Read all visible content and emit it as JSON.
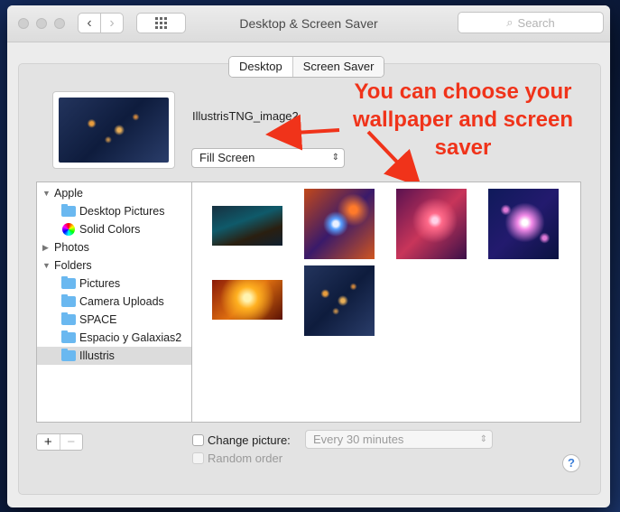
{
  "window": {
    "title": "Desktop & Screen Saver"
  },
  "search": {
    "placeholder": "Search"
  },
  "tabs": [
    {
      "label": "Desktop"
    },
    {
      "label": "Screen Saver"
    }
  ],
  "current_image": {
    "name": "IllustrisTNG_image2"
  },
  "fill_mode": {
    "selected": "Fill Screen"
  },
  "annotation": {
    "text": "You can choose your wallpaper and screen saver"
  },
  "sidebar": {
    "items": [
      {
        "label": "Apple"
      },
      {
        "label": "Desktop Pictures"
      },
      {
        "label": "Solid Colors"
      },
      {
        "label": "Photos"
      },
      {
        "label": "Folders"
      },
      {
        "label": "Pictures"
      },
      {
        "label": "Camera Uploads"
      },
      {
        "label": "SPACE"
      },
      {
        "label": "Espacio y Galaxias2"
      },
      {
        "label": "Illustris"
      }
    ]
  },
  "buttons": {
    "add": "+",
    "remove": "−",
    "help": "?"
  },
  "change_picture": {
    "label": "Change picture:",
    "interval": "Every 30 minutes"
  },
  "random_order": {
    "label": "Random order"
  }
}
